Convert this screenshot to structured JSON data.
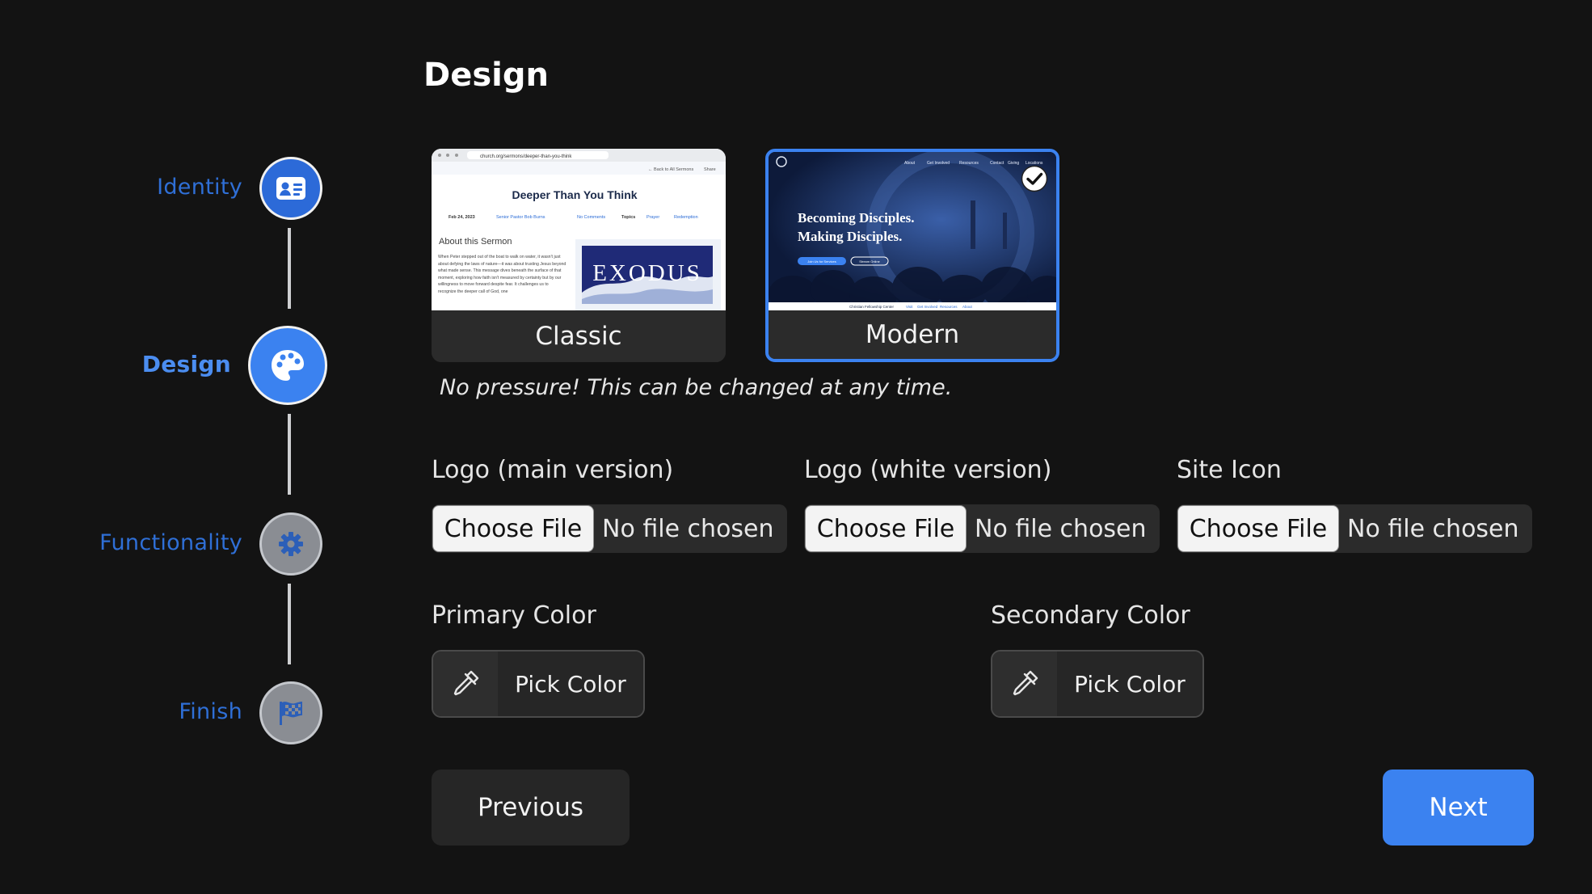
{
  "page": {
    "title": "Design"
  },
  "steps": [
    {
      "label": "Identity",
      "state": "done",
      "icon": "id-card-icon"
    },
    {
      "label": "Design",
      "state": "active",
      "icon": "palette-icon"
    },
    {
      "label": "Functionality",
      "state": "todo",
      "icon": "gear-icon"
    },
    {
      "label": "Finish",
      "state": "todo",
      "icon": "checkered-flag-icon"
    }
  ],
  "themes": {
    "classic": {
      "label": "Classic",
      "preview": {
        "url": "church.org/sermons/deeper-than-you-think",
        "back_link": "← Back to All Sermons",
        "share": "Share",
        "heading": "Deeper Than You Think",
        "meta_date": "Feb 24, 2023",
        "meta_author": "Senior Pastor Bob Burns",
        "meta_comments": "No Comments",
        "meta_topics": "Topics",
        "meta_tag1": "Prayer",
        "meta_tag2": "Redemption",
        "about": "About this Sermon",
        "body": "When Peter stepped out of the boat to walk on water, it wasn't just about defying the laws of nature—it was about trusting Jesus beyond what made sense. This message dives beneath the surface of that moment, exploring how faith isn't measured by certainty but by our willingness to move forward despite fear. It challenges us to recognize the deeper call of God, one",
        "series_art": "EXODUS"
      }
    },
    "modern": {
      "label": "Modern",
      "selected": true,
      "preview": {
        "nav": [
          "About",
          "Get Involved",
          "Resources",
          "Contact",
          "Giving",
          "Locations"
        ],
        "headline_1": "Becoming Disciples.",
        "headline_2": "Making Disciples.",
        "cta_1": "Join Us for Services",
        "cta_2": "Stream Online",
        "footer_brand": "Christian Fellowship Center",
        "footer_links": [
          "Visit",
          "Get Involved",
          "Resources",
          "About"
        ]
      }
    }
  },
  "note": "No pressure! This can be changed at any time.",
  "uploads": [
    {
      "label": "Logo (main version)",
      "button": "Choose File",
      "status": "No file chosen"
    },
    {
      "label": "Logo (white version)",
      "button": "Choose File",
      "status": "No file chosen"
    },
    {
      "label": "Site Icon",
      "button": "Choose File",
      "status": "No file chosen"
    }
  ],
  "colors": {
    "primary": {
      "label": "Primary Color",
      "button": "Pick Color"
    },
    "secondary": {
      "label": "Secondary Color",
      "button": "Pick Color"
    }
  },
  "nav_buttons": {
    "previous": "Previous",
    "next": "Next"
  },
  "accent": "#3b82f0"
}
